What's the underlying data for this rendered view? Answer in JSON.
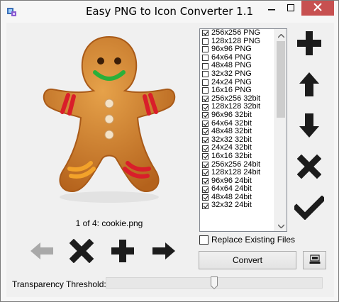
{
  "window": {
    "title": "Easy PNG to Icon Converter 1.1",
    "app_icon": "png-converter-icon",
    "controls": [
      "minimize-icon",
      "maximize-icon",
      "close-icon"
    ]
  },
  "preview": {
    "image": "gingerbread-man-icon",
    "caption": "1 of 4: cookie.png"
  },
  "nav_buttons": [
    {
      "icon": "arrow-left-icon",
      "enabled": false
    },
    {
      "icon": "remove-x-icon",
      "enabled": true
    },
    {
      "icon": "add-plus-icon",
      "enabled": true
    },
    {
      "icon": "arrow-right-icon",
      "enabled": true
    }
  ],
  "formats": [
    {
      "label": "256x256 PNG",
      "checked": true
    },
    {
      "label": "128x128 PNG",
      "checked": false
    },
    {
      "label": "96x96 PNG",
      "checked": false
    },
    {
      "label": "64x64 PNG",
      "checked": false
    },
    {
      "label": "48x48 PNG",
      "checked": false
    },
    {
      "label": "32x32 PNG",
      "checked": false
    },
    {
      "label": "24x24 PNG",
      "checked": false
    },
    {
      "label": "16x16 PNG",
      "checked": false
    },
    {
      "label": "256x256 32bit",
      "checked": true
    },
    {
      "label": "128x128 32bit",
      "checked": true
    },
    {
      "label": "96x96 32bit",
      "checked": true
    },
    {
      "label": "64x64 32bit",
      "checked": true
    },
    {
      "label": "48x48 32bit",
      "checked": true
    },
    {
      "label": "32x32 32bit",
      "checked": true
    },
    {
      "label": "24x24 32bit",
      "checked": true
    },
    {
      "label": "16x16 32bit",
      "checked": true
    },
    {
      "label": "256x256 24bit",
      "checked": true
    },
    {
      "label": "128x128 24bit",
      "checked": true
    },
    {
      "label": "96x96 24bit",
      "checked": true
    },
    {
      "label": "64x64 24bit",
      "checked": true
    },
    {
      "label": "48x48 24bit",
      "checked": true
    },
    {
      "label": "32x32 24bit",
      "checked": true
    }
  ],
  "side_buttons": [
    "add-plus-icon",
    "arrow-up-icon",
    "arrow-down-icon",
    "remove-x-icon",
    "checkmark-icon"
  ],
  "replace_existing": {
    "label": "Replace Existing Files",
    "checked": false
  },
  "convert_label": "Convert",
  "computer_button_icon": "computer-icon",
  "threshold": {
    "label": "Transparency Threshold:",
    "value_fraction": 0.5
  }
}
